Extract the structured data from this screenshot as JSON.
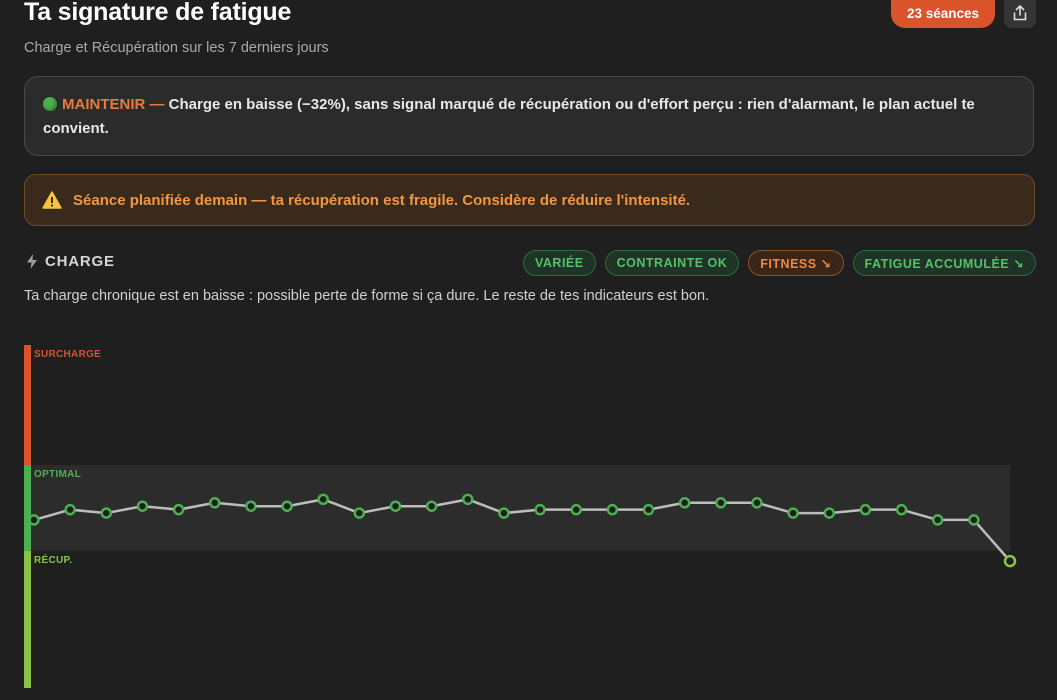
{
  "header": {
    "title": "Ta signature de fatigue",
    "subtitle": "Charge et Récupération sur les 7 derniers jours",
    "sessions_badge": "23 séances",
    "share_icon": "share-icon"
  },
  "advice": {
    "status_icon": "green-circle-icon",
    "status": "MAINTENIR —",
    "text": " Charge en baisse (−32%), sans signal marqué de récupération ou d'effort perçu : rien d'alarmant, le plan actuel te convient."
  },
  "warning": {
    "icon": "warning-triangle-icon",
    "text": "Séance planifiée demain — ta récupération est fragile. Considère de réduire l'intensité."
  },
  "section": {
    "icon": "lightning-icon",
    "title": "CHARGE",
    "description": "Ta charge chronique est en baisse : possible perte de forme si ça dure. Le reste de tes indicateurs est bon.",
    "chips": [
      {
        "label": "VARIÉE",
        "tone": "green"
      },
      {
        "label": "CONTRAINTE OK",
        "tone": "green"
      },
      {
        "label": "FITNESS ↘",
        "tone": "orange"
      },
      {
        "label": "FATIGUE ACCUMULÉE ↘",
        "tone": "green"
      }
    ]
  },
  "colors": {
    "accent": "#d9532b",
    "surcharge": "#d9532b",
    "optimal": "#4caf50",
    "recup": "#8bc34a",
    "line": "#bdbdbd"
  },
  "chart_data": {
    "type": "line",
    "zones": [
      {
        "label": "SURCHARGE",
        "from": 0.65,
        "to": 1.0
      },
      {
        "label": "OPTIMAL",
        "from": 0.4,
        "to": 0.65
      },
      {
        "label": "RÉCUP.",
        "from": 0.0,
        "to": 0.4
      }
    ],
    "ylim": [
      0,
      1
    ],
    "series": [
      {
        "values": [
          0.49,
          0.52,
          0.51,
          0.53,
          0.52,
          0.54,
          0.53,
          0.53,
          0.55,
          0.51,
          0.53,
          0.53,
          0.55,
          0.51,
          0.52,
          0.52,
          0.52,
          0.52,
          0.54,
          0.54,
          0.54,
          0.51,
          0.51,
          0.52,
          0.52,
          0.49,
          0.49,
          0.37
        ]
      }
    ]
  }
}
